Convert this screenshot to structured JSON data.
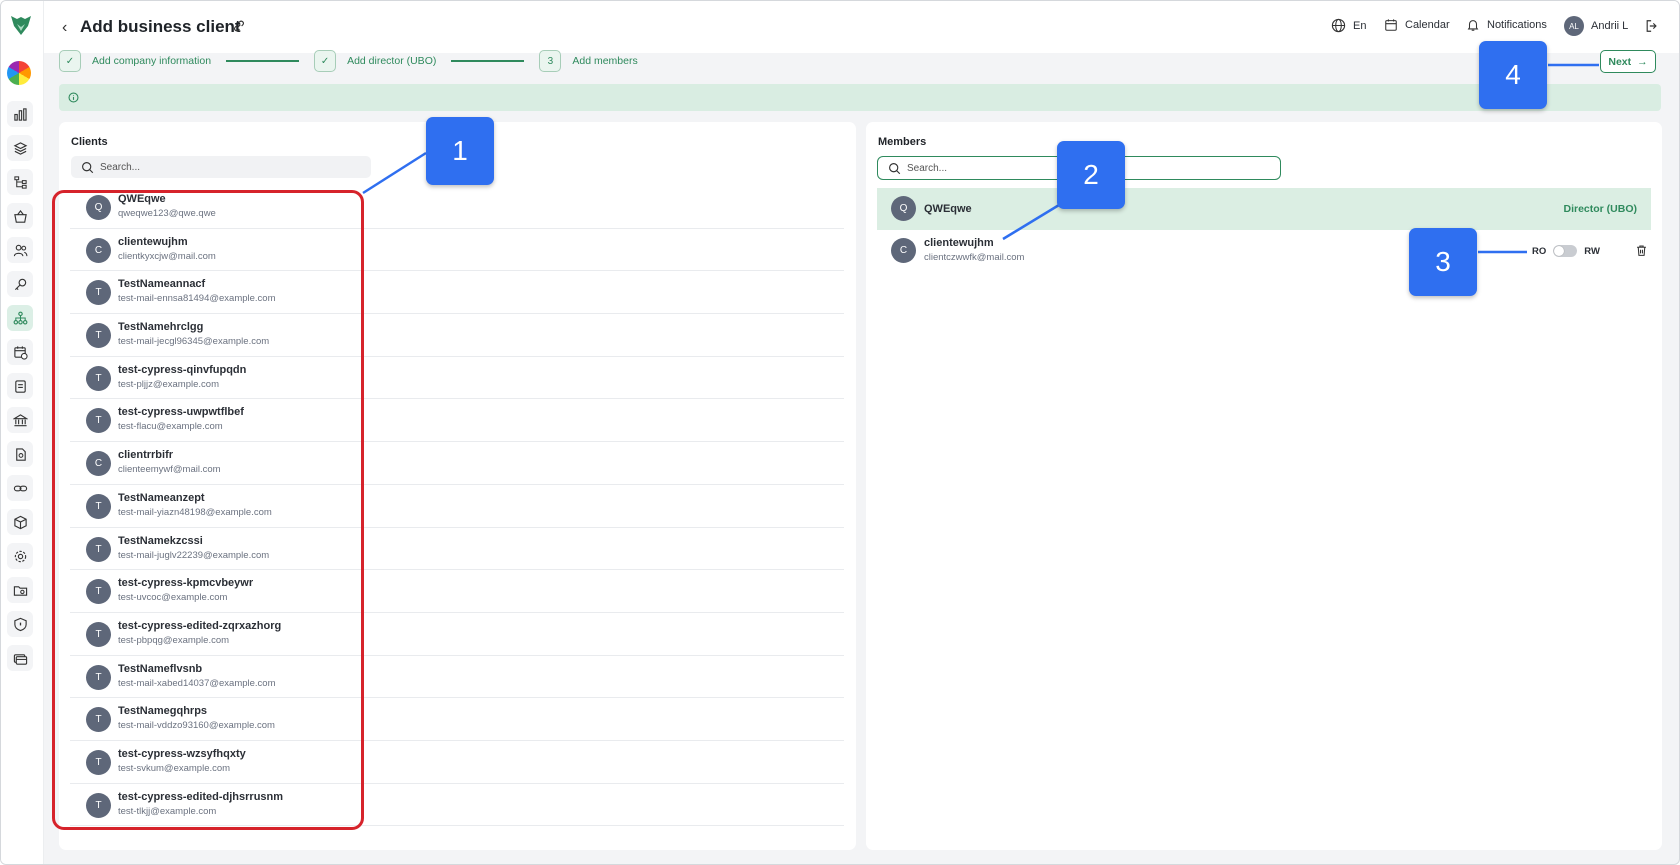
{
  "header": {
    "title": "Add business client",
    "language": "En",
    "calendar": "Calendar",
    "notifications": "Notifications",
    "user_initials": "AL",
    "user_name": "Andrii L"
  },
  "stepper": {
    "steps": [
      {
        "label": "Add company information",
        "marker": "✓"
      },
      {
        "label": "Add director (UBO)",
        "marker": "✓"
      },
      {
        "label": "Add members",
        "marker": "3"
      }
    ],
    "next_label": "Next"
  },
  "clients_panel": {
    "title": "Clients",
    "search_placeholder": "Search...",
    "items": [
      {
        "initial": "Q",
        "name": "QWEqwe",
        "email": "qweqwe123@qwe.qwe"
      },
      {
        "initial": "C",
        "name": "clientewujhm",
        "email": "clientkyxcjw@mail.com"
      },
      {
        "initial": "T",
        "name": "TestNameannacf",
        "email": "test-mail-ennsa81494@example.com"
      },
      {
        "initial": "T",
        "name": "TestNamehrclgg",
        "email": "test-mail-jecgl96345@example.com"
      },
      {
        "initial": "T",
        "name": "test-cypress-qinvfupqdn",
        "email": "test-pljjz@example.com"
      },
      {
        "initial": "T",
        "name": "test-cypress-uwpwtflbef",
        "email": "test-flacu@example.com"
      },
      {
        "initial": "C",
        "name": "clientrrbifr",
        "email": "clienteemywf@mail.com"
      },
      {
        "initial": "T",
        "name": "TestNameanzept",
        "email": "test-mail-yiazn48198@example.com"
      },
      {
        "initial": "T",
        "name": "TestNamekzcssi",
        "email": "test-mail-juglv22239@example.com"
      },
      {
        "initial": "T",
        "name": "test-cypress-kpmcvbeywr",
        "email": "test-uvcoc@example.com"
      },
      {
        "initial": "T",
        "name": "test-cypress-edited-zqrxazhorg",
        "email": "test-pbpqg@example.com"
      },
      {
        "initial": "T",
        "name": "TestNameflvsnb",
        "email": "test-mail-xabed14037@example.com"
      },
      {
        "initial": "T",
        "name": "TestNamegqhrps",
        "email": "test-mail-vddzo93160@example.com"
      },
      {
        "initial": "T",
        "name": "test-cypress-wzsyfhqxty",
        "email": "test-svkum@example.com"
      },
      {
        "initial": "T",
        "name": "test-cypress-edited-djhsrrusnm",
        "email": "test-tlkjj@example.com"
      }
    ]
  },
  "members_panel": {
    "title": "Members",
    "search_placeholder": "Search...",
    "director": {
      "initial": "Q",
      "name": "QWEqwe",
      "role": "Director (UBO)"
    },
    "member": {
      "initial": "C",
      "name": "clientewujhm",
      "email": "clientczwwfk@mail.com",
      "ro_label": "RO",
      "rw_label": "RW"
    }
  },
  "callouts": [
    "1",
    "2",
    "3",
    "4"
  ],
  "colors": {
    "accent": "#2f8a5d",
    "callout": "#2f6ff0",
    "highlight": "#d6232b",
    "avatar": "#5e6779"
  }
}
